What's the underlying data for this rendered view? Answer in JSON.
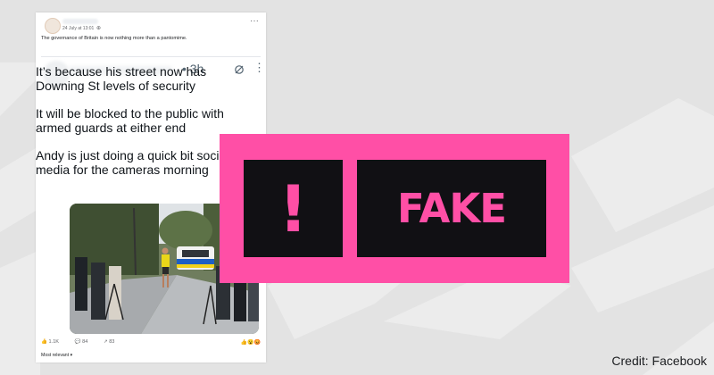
{
  "colors": {
    "background": "#e3e3e3",
    "badge_pink": "#ff4fa6",
    "badge_black": "#111014"
  },
  "facebook_post": {
    "timestamp": "24 July at 13:01",
    "caption": "The governance of Britain is now nothing more than a pantomime.",
    "more_icon": "more-horizontal-icon",
    "reactions": {
      "likes": "1.1K",
      "comments": "84",
      "shares": "83"
    },
    "comment_filter": "Most relevant ▾"
  },
  "tweet": {
    "time": "• 3h",
    "paragraphs": [
      "It’s because his street now has Downing St levels of security",
      "It will be blocked to the public with armed guards at either end",
      "Andy is just doing a quick bit social media for the cameras morning"
    ]
  },
  "badge": {
    "icon": "!",
    "label": "FAKE"
  },
  "credit": "Credit: Facebook"
}
